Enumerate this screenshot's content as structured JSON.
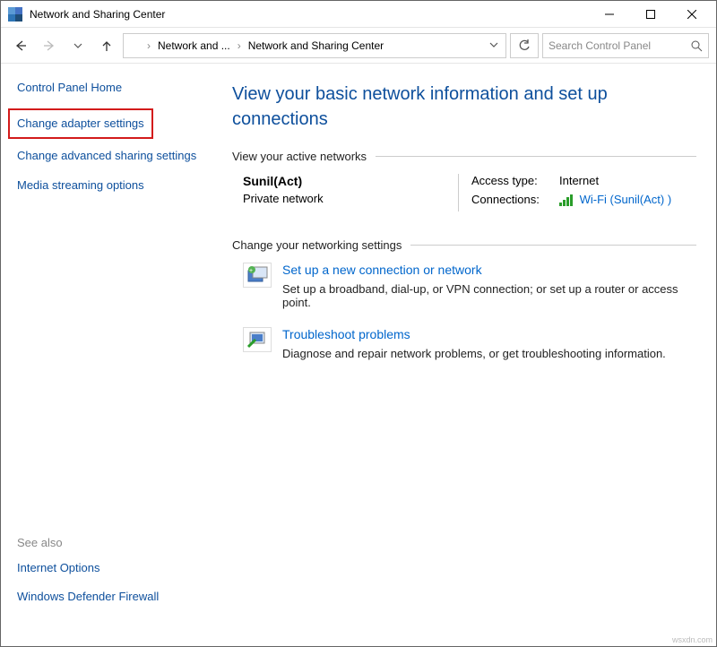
{
  "window": {
    "title": "Network and Sharing Center"
  },
  "breadcrumb": {
    "seg1": "Network and ...",
    "seg2": "Network and Sharing Center"
  },
  "search": {
    "placeholder": "Search Control Panel"
  },
  "sidebar": {
    "home": "Control Panel Home",
    "change_adapter": "Change adapter settings",
    "change_advanced": "Change advanced sharing settings",
    "media_stream": "Media streaming options",
    "see_also_hdr": "See also",
    "internet_options": "Internet Options",
    "firewall": "Windows Defender Firewall"
  },
  "main": {
    "heading": "View your basic network information and set up connections",
    "active_hdr": "View your active networks",
    "net": {
      "name": "Sunil(Act)",
      "type": "Private network",
      "access_label": "Access type:",
      "access_value": "Internet",
      "conn_label": "Connections:",
      "conn_value": "Wi-Fi (Sunil(Act) )"
    },
    "change_hdr": "Change your networking settings",
    "task1": {
      "title": "Set up a new connection or network",
      "desc": "Set up a broadband, dial-up, or VPN connection; or set up a router or access point."
    },
    "task2": {
      "title": "Troubleshoot problems",
      "desc": "Diagnose and repair network problems, or get troubleshooting information."
    }
  },
  "watermark": "wsxdn.com"
}
